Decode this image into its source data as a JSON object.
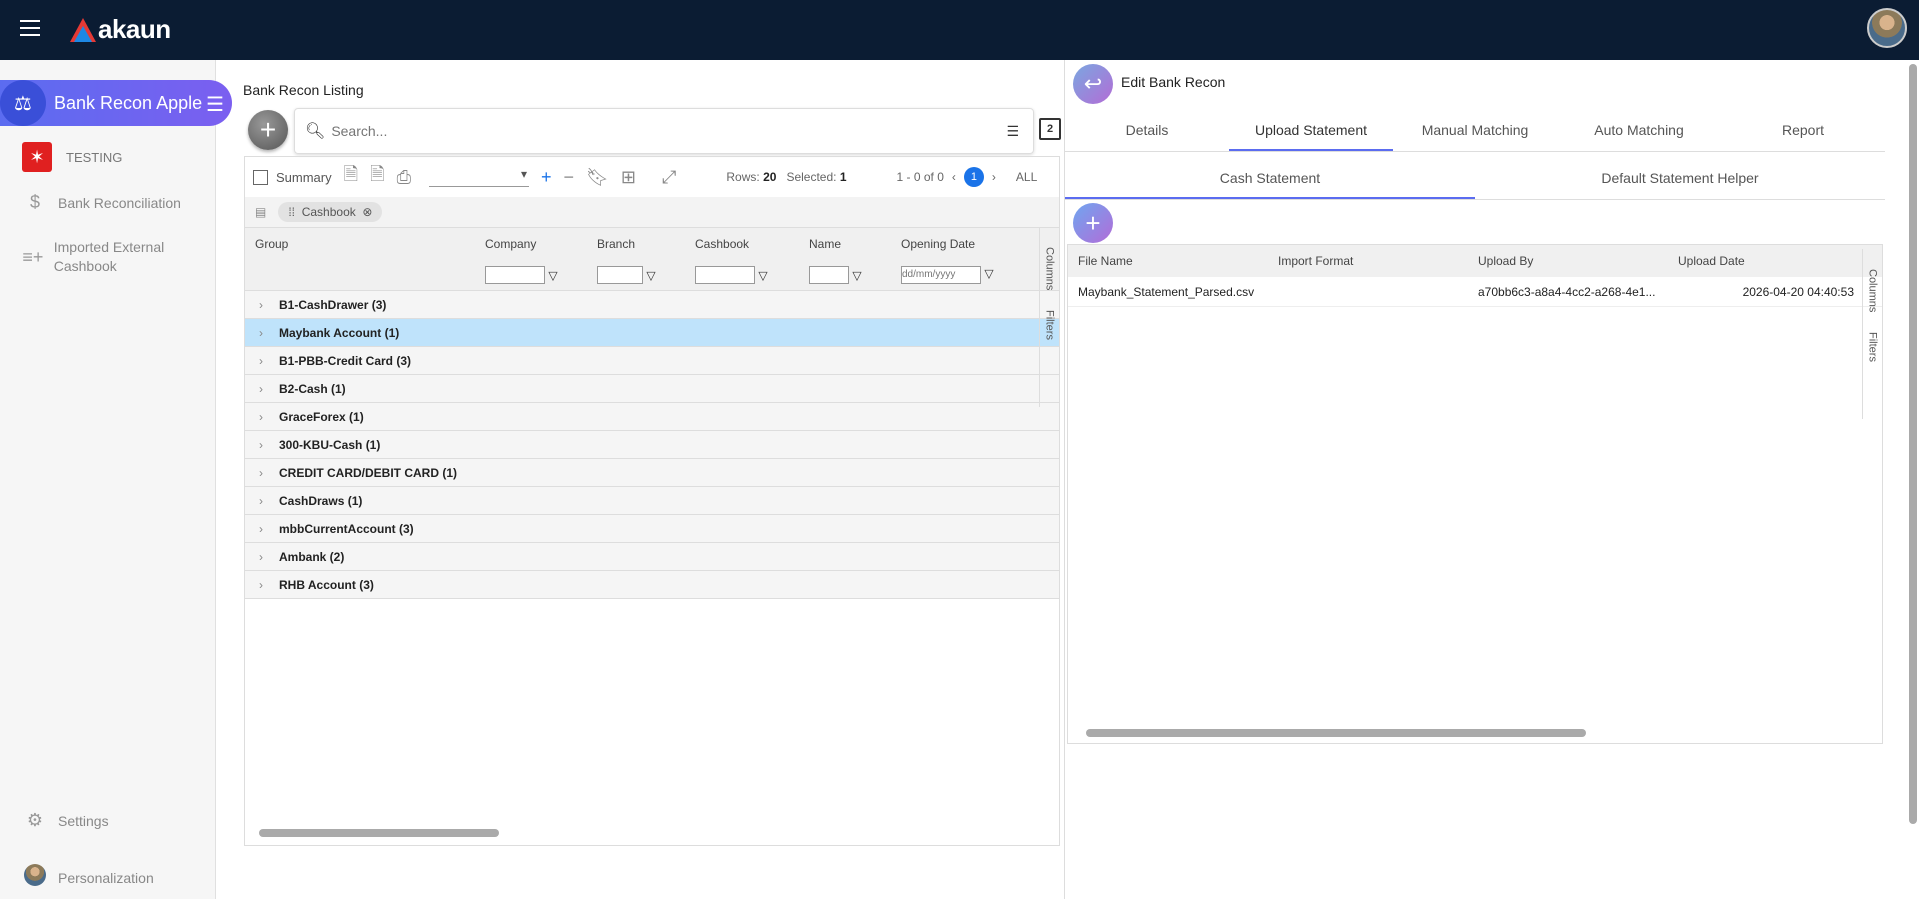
{
  "app": {
    "brand": "akaun",
    "name": "Bank Recon Apple"
  },
  "sidebar": {
    "company": "TESTING",
    "items": [
      {
        "label": "Bank Reconciliation",
        "icon": "dollar-icon"
      },
      {
        "label": "Imported External Cashbook",
        "icon": "playlist-add-icon"
      }
    ],
    "settings": "Settings",
    "personalization": "Personalization"
  },
  "left": {
    "title": "Bank Recon Listing",
    "search_placeholder": "Search...",
    "summary_label": "Summary",
    "rows_label": "Rows:",
    "rows_value": "20",
    "selected_label": "Selected:",
    "selected_value": "1",
    "pager_range": "1 - 0 of 0",
    "current_page": "1",
    "all_label": "ALL",
    "chip": "Cashbook",
    "copy_badge": "2",
    "columns": [
      "Group",
      "Company",
      "Branch",
      "Cashbook",
      "Name",
      "Opening Date"
    ],
    "date_placeholder": "dd/mm/yyyy",
    "groups": [
      "B1-CashDrawer (3)",
      "Maybank Account (1)",
      "B1-PBB-Credit Card (3)",
      "B2-Cash (1)",
      "GraceForex (1)",
      "300-KBU-Cash (1)",
      "CREDIT CARD/DEBIT CARD (1)",
      "CashDraws (1)",
      "mbbCurrentAccount (3)",
      "Ambank (2)",
      "RHB Account (3)"
    ],
    "side_tabs": [
      "Columns",
      "Filters"
    ]
  },
  "right": {
    "title": "Edit Bank Recon",
    "tabs": [
      "Details",
      "Upload Statement",
      "Manual Matching",
      "Auto Matching",
      "Report"
    ],
    "subtabs": [
      "Cash Statement",
      "Default Statement Helper"
    ],
    "columns": [
      "File Name",
      "Import Format",
      "Upload By",
      "Upload Date"
    ],
    "row": {
      "file": "Maybank_Statement_Parsed.csv",
      "format": "",
      "by": "a70bb6c3-a8a4-4cc2-a268-4e1...",
      "date": "2026-04-20 04:40:53"
    },
    "side_tabs": [
      "Columns",
      "Filters"
    ]
  }
}
